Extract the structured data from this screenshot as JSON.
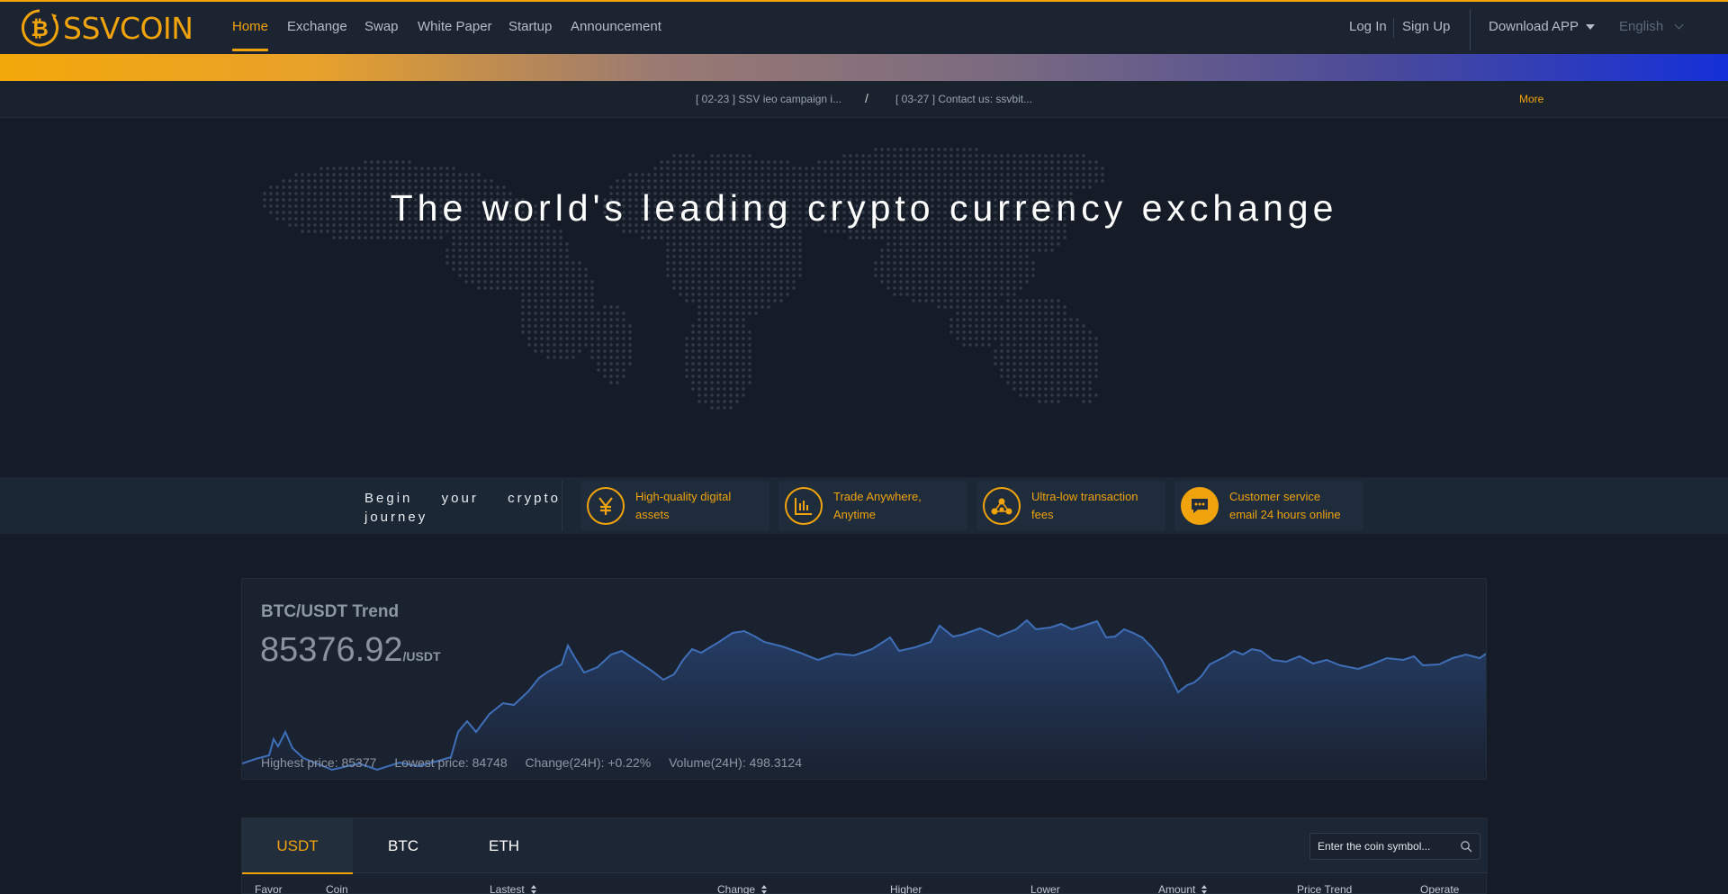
{
  "brand": {
    "name": "SSVCOIN",
    "logo_icon": "bitcoin-icon",
    "accent": "#f0a30a"
  },
  "nav": [
    {
      "label": "Home",
      "active": true
    },
    {
      "label": "Exchange"
    },
    {
      "label": "Swap"
    },
    {
      "label": "White Paper"
    },
    {
      "label": "Startup"
    },
    {
      "label": "Announcement"
    }
  ],
  "header": {
    "login": "Log In",
    "signup": "Sign Up",
    "download": "Download APP",
    "language": "English"
  },
  "notices": {
    "items": [
      "[ 02-23 ] SSV ieo campaign i...",
      "[ 03-27 ] Contact us: ssvbit..."
    ],
    "separator": "/",
    "more": "More"
  },
  "hero": {
    "title": "The world's leading crypto currency exchange"
  },
  "features": {
    "intro": "Begin your crypto journey",
    "items": [
      {
        "icon": "yen-icon",
        "line1": "High-quality digital",
        "line2": "assets"
      },
      {
        "icon": "chart-icon",
        "line1": "Trade Anywhere,",
        "line2": "Anytime"
      },
      {
        "icon": "network-icon",
        "line1": "Ultra-low transaction",
        "line2": "fees"
      },
      {
        "icon": "chat-icon",
        "line1": "Customer service",
        "line2": "email 24 hours online"
      }
    ]
  },
  "trend": {
    "title": "BTC/USDT Trend",
    "price": "85376.92",
    "unit": "/USDT",
    "high": "Highest price: 85377",
    "low": "Lowest price: 84748",
    "change": "Change(24H): +0.22%",
    "volume": "Volume(24H): 498.3124",
    "line_color": "#3f6fb8"
  },
  "markets": {
    "tabs": [
      "USDT",
      "BTC",
      "ETH"
    ],
    "active_tab": "USDT",
    "search_placeholder": "Enter the coin symbol...",
    "columns": [
      "Favor",
      "Coin",
      "Lastest",
      "Change",
      "Higher",
      "Lower",
      "Amount",
      "Price Trend",
      "Operate"
    ]
  }
}
